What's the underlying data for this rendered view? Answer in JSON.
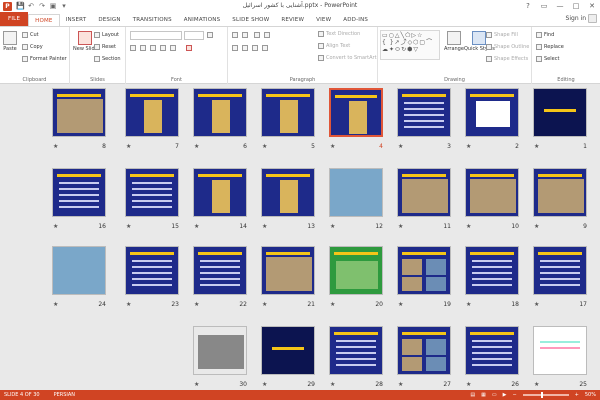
{
  "window": {
    "title": "آشنایی با کشور اسرائیل.pptx - PowerPoint",
    "app_icon_label": "P",
    "controls": [
      "?",
      "▭",
      "—",
      "□",
      "✕"
    ]
  },
  "qat": [
    "💾",
    "↶",
    "↷",
    "▣",
    "▾"
  ],
  "tabs": [
    {
      "label": "FILE"
    },
    {
      "label": "HOME"
    },
    {
      "label": "INSERT"
    },
    {
      "label": "DESIGN"
    },
    {
      "label": "TRANSITIONS"
    },
    {
      "label": "ANIMATIONS"
    },
    {
      "label": "SLIDE SHOW"
    },
    {
      "label": "REVIEW"
    },
    {
      "label": "VIEW"
    },
    {
      "label": "ADD-INS"
    }
  ],
  "signin": "Sign in",
  "ribbon": {
    "clipboard": {
      "label": "Clipboard",
      "paste": "Paste",
      "cut": "Cut",
      "copy": "Copy",
      "format_painter": "Format Painter"
    },
    "slides": {
      "label": "Slides",
      "new_slide": "New Slide",
      "layout": "Layout",
      "reset": "Reset",
      "section": "Section"
    },
    "font": {
      "label": "Font"
    },
    "paragraph": {
      "label": "Paragraph",
      "text_direction": "Text Direction",
      "align_text": "Align Text",
      "convert": "Convert to SmartArt"
    },
    "drawing": {
      "label": "Drawing",
      "arrange": "Arrange",
      "quick_styles": "Quick Styles",
      "shape_fill": "Shape Fill",
      "shape_outline": "Shape Outline",
      "shape_effects": "Shape Effects"
    },
    "editing": {
      "label": "Editing",
      "find": "Find",
      "replace": "Replace",
      "select": "Select"
    }
  },
  "slides": [
    {
      "n": "1",
      "kind": "title-dark"
    },
    {
      "n": "2",
      "kind": "flag"
    },
    {
      "n": "3",
      "kind": "text"
    },
    {
      "n": "4",
      "kind": "map",
      "selected": true
    },
    {
      "n": "5",
      "kind": "map"
    },
    {
      "n": "6",
      "kind": "map"
    },
    {
      "n": "7",
      "kind": "map"
    },
    {
      "n": "8",
      "kind": "photo"
    },
    {
      "n": "9",
      "kind": "photo"
    },
    {
      "n": "10",
      "kind": "photo"
    },
    {
      "n": "11",
      "kind": "photo"
    },
    {
      "n": "12",
      "kind": "sea"
    },
    {
      "n": "13",
      "kind": "maps"
    },
    {
      "n": "14",
      "kind": "map"
    },
    {
      "n": "15",
      "kind": "text"
    },
    {
      "n": "16",
      "kind": "text"
    },
    {
      "n": "17",
      "kind": "table"
    },
    {
      "n": "18",
      "kind": "text"
    },
    {
      "n": "19",
      "kind": "portraits"
    },
    {
      "n": "20",
      "kind": "green"
    },
    {
      "n": "21",
      "kind": "photo"
    },
    {
      "n": "22",
      "kind": "text"
    },
    {
      "n": "23",
      "kind": "text"
    },
    {
      "n": "24",
      "kind": "sea"
    },
    {
      "n": "25",
      "kind": "white"
    },
    {
      "n": "26",
      "kind": "text"
    },
    {
      "n": "27",
      "kind": "collage"
    },
    {
      "n": "28",
      "kind": "text"
    },
    {
      "n": "29",
      "kind": "title-dark"
    },
    {
      "n": "30",
      "kind": "laptop"
    }
  ],
  "status": {
    "slide_info": "SLIDE 4 OF 30",
    "language": "PERSIAN",
    "zoom": "50%"
  },
  "colors": {
    "accent": "#d04423",
    "slide_bg": "#1e2a8a",
    "title_yellow": "#f5c518"
  }
}
